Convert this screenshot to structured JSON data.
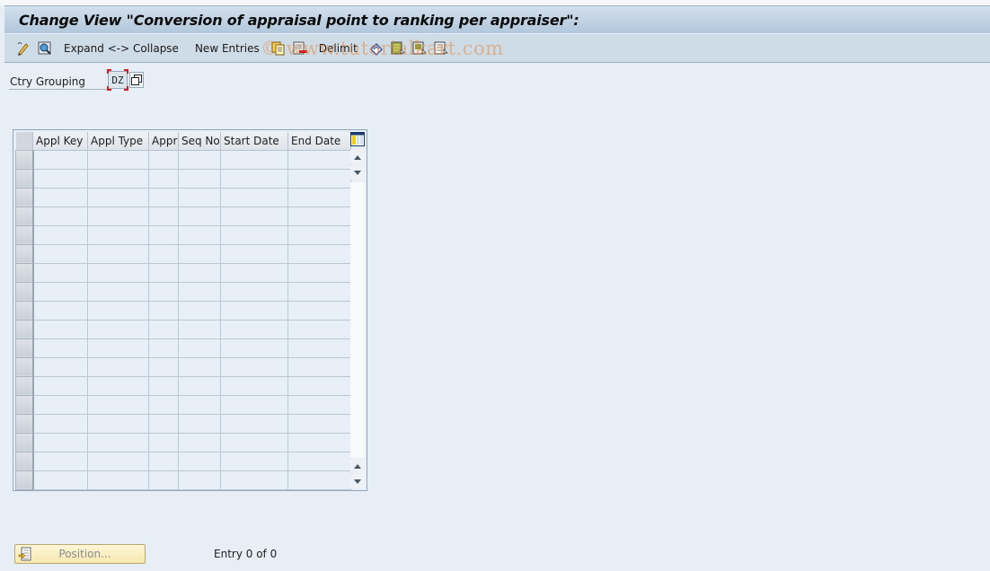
{
  "window": {
    "title": "Change View \"Conversion of appraisal point to ranking per appraiser\":"
  },
  "toolbar": {
    "items": [
      {
        "type": "icon",
        "name": "display-change-icon"
      },
      {
        "type": "icon",
        "name": "where-used-icon"
      },
      {
        "type": "text",
        "label": "Expand <-> Collapse"
      },
      {
        "type": "text",
        "label": "New Entries"
      },
      {
        "type": "icon",
        "name": "copy-as-icon"
      },
      {
        "type": "icon",
        "name": "delete-icon"
      },
      {
        "type": "text",
        "label": "Delimit"
      },
      {
        "type": "icon",
        "name": "undo-change-icon"
      },
      {
        "type": "icon",
        "name": "select-all-icon"
      },
      {
        "type": "icon",
        "name": "select-block-icon"
      },
      {
        "type": "icon",
        "name": "deselect-all-icon"
      }
    ],
    "expand_collapse_label": "Expand <-> Collapse",
    "new_entries_label": "New Entries",
    "delimit_label": "Delimit"
  },
  "watermark": "© www.tutorialkart.com",
  "filter": {
    "label": "Ctry Grouping",
    "value": "DZ"
  },
  "table": {
    "columns": [
      "Appl Key",
      "Appl Type",
      "Appr",
      "Seq No",
      "Start Date",
      "End Date"
    ],
    "row_count_visible": 18,
    "rows": []
  },
  "footer": {
    "position_button_label": "Position...",
    "entry_info": "Entry 0 of 0"
  }
}
